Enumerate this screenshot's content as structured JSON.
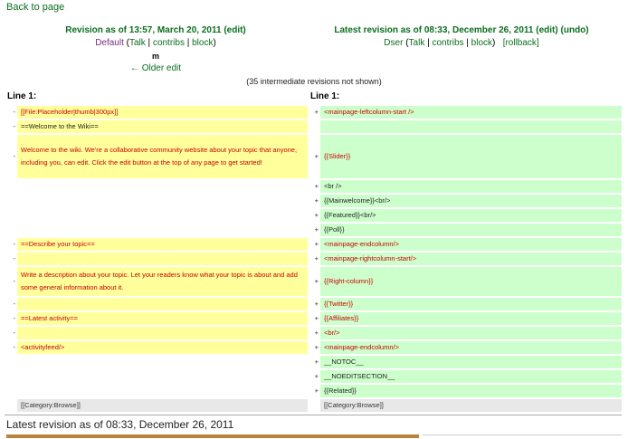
{
  "nav": {
    "back_label": "Back to page"
  },
  "left_rev": {
    "title": "Revision as of 13:57, March 20, 2011",
    "edit": "(edit)",
    "user": "Default",
    "talk": "Talk",
    "contribs": "contribs",
    "block": "block",
    "summary": "m",
    "older": "← Older edit"
  },
  "right_rev": {
    "title": "Latest revision as of 08:33, December 26, 2011",
    "edit": "(edit)",
    "undo": "(undo)",
    "user": "Dser",
    "talk": "Talk",
    "contribs": "contribs",
    "block": "block",
    "rollback": "[rollback]"
  },
  "hidden_note": "(35 intermediate revisions not shown)",
  "line_label_left": "Line 1:",
  "line_label_right": "Line 1:",
  "rows": [
    {
      "lm": "-",
      "l": "[[File:Placeholder|thumb|300px]]",
      "ls": "del",
      "rm": "+",
      "r": "<mainpage-leftcolumn-start />",
      "rs": "add"
    },
    {
      "lm": "-",
      "l": "==Welcome to the Wiki==",
      "ls": "del plain",
      "rm": "",
      "r": "",
      "rs": "add"
    },
    {
      "lm": "-",
      "l": "Welcome to the wiki. We're a collaborative community website about your topic that anyone, including you, can edit. Click the edit button at the top of any page to get started!",
      "ls": "del",
      "rm": "+",
      "r": "{{Slider}}",
      "rs": "add"
    },
    {
      "lm": "",
      "l": "",
      "ls": "blank",
      "rm": "+",
      "r": "<br />",
      "rs": "add plain"
    },
    {
      "lm": "",
      "l": "",
      "ls": "blank",
      "rm": "+",
      "r": "{{Mainwelcome}}<br/>",
      "rs": "add plain"
    },
    {
      "lm": "",
      "l": "",
      "ls": "blank",
      "rm": "+",
      "r": "{{Featured}}<br/>",
      "rs": "add plain"
    },
    {
      "lm": "",
      "l": "",
      "ls": "blank",
      "rm": "+",
      "r": "{{Poll}}",
      "rs": "add plain"
    },
    {
      "lm": "-",
      "l": "==Describe your topic==",
      "ls": "del",
      "rm": "+",
      "r": "<mainpage-endcolumn/>",
      "rs": "add"
    },
    {
      "lm": "-",
      "l": "",
      "ls": "del",
      "rm": "+",
      "r": "<mainpage-rightcolumn-start/>",
      "rs": "add"
    },
    {
      "lm": "-",
      "l": "Write a description about your topic. Let your readers know what your topic is about and add some general information about it.",
      "ls": "del",
      "rm": "+",
      "r": "{{Right-column}}",
      "rs": "add"
    },
    {
      "lm": "-",
      "l": "",
      "ls": "del",
      "rm": "+",
      "r": "{{Twitter}}",
      "rs": "add"
    },
    {
      "lm": "-",
      "l": "==Latest activity==",
      "ls": "del",
      "rm": "+",
      "r": "{{Affiliates}}",
      "rs": "add"
    },
    {
      "lm": "-",
      "l": "",
      "ls": "del",
      "rm": "+",
      "r": "<br/>",
      "rs": "add"
    },
    {
      "lm": "-",
      "l": "<activityfeed/>",
      "ls": "del",
      "rm": "+",
      "r": "<mainpage-endcolumn/>",
      "rs": "add"
    },
    {
      "lm": "",
      "l": "",
      "ls": "blank",
      "rm": "+",
      "r": "__NOTOC__",
      "rs": "add plain"
    },
    {
      "lm": "",
      "l": "",
      "ls": "blank",
      "rm": "+",
      "r": "__NOEDITSECTION__",
      "rs": "add plain"
    },
    {
      "lm": "",
      "l": "",
      "ls": "blank",
      "rm": "+",
      "r": "{{Related}}",
      "rs": "add plain"
    },
    {
      "lm": "",
      "l": "[[Category:Browse]]",
      "ls": "ctx",
      "rm": "",
      "r": "[[Category:Browse]]",
      "rs": "ctx"
    }
  ],
  "latest_heading": "Latest revision as of 08:33, December 26, 2011"
}
